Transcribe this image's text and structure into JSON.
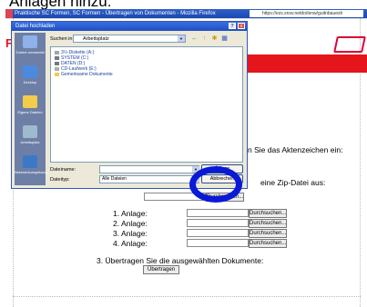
{
  "page_heading": "Anlagen hinzu:",
  "browser": {
    "title": "Praktische SC Formen, SC Formen - Übertragen von Dokumenten - Mozilla Firefox",
    "url": "https://ezs.xnsv.netdo/ienw/guitnbauesh"
  },
  "dialog": {
    "title": "Datei hochladen",
    "close": "x",
    "help": "?",
    "lookin_label": "Suchen in:",
    "lookin_value": "Arbeitsplatz",
    "dropdown_arrow": "▼",
    "back_icon": "←",
    "up_icon": "↑",
    "newfolder_icon": "✱",
    "view_icon": "▦",
    "places": [
      {
        "label": "Zuletzt verwendet"
      },
      {
        "label": "Desktop"
      },
      {
        "label": "Eigene Dateien"
      },
      {
        "label": "Arbeitsplatz"
      },
      {
        "label": "Netzwerkumgebung"
      }
    ],
    "files": [
      "3½-Diskette (A:)",
      "SYSTEM (C:)",
      "DATEN (D:)",
      "CD-Laufwerk (E:)",
      "Gemeinsame Dokumente"
    ],
    "filename_label": "Dateiname:",
    "filetype_label": "Dateityp:",
    "filetype_value": "Alle Dateien",
    "open_button": "Öffnen",
    "cancel_button": "Abbrechen"
  },
  "sidebar_letters": [
    "G",
    "N",
    "E",
    "F",
    "C",
    "A"
  ],
  "form": {
    "aktenzeichen_text": "n Sie das Aktenzeichen ein:",
    "zip_text": "eine Zip-Datei aus:",
    "browse_label": "Durchsuchen...",
    "anlagen": [
      "1. Anlage:",
      "2. Anlage:",
      "3. Anlage:",
      "4. Anlage:"
    ],
    "step3_text": "3. Übertragen Sie die ausgewählten Dokumente:",
    "submit_label": "Übertragen"
  },
  "colors": {
    "highlight_ring": "#0a19d6",
    "brand_red": "#e4161b",
    "dialog_bg": "#ece9d8"
  }
}
